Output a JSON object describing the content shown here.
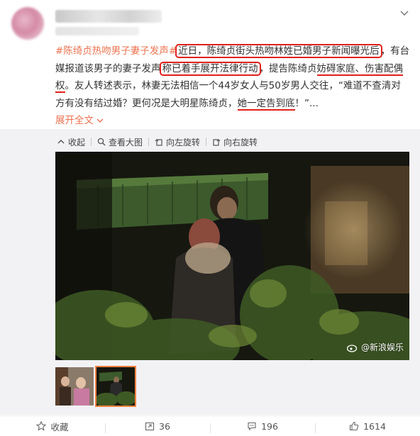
{
  "colors": {
    "accent": "#eb7350",
    "highlight": "#e0201a",
    "thumb_border": "#ff8140"
  },
  "post": {
    "topic": "#陈绮贞热吻男子妻子发声#",
    "seg1": "近日，陈绮贞街头热吻林姓已婚男子新闻曝光后",
    "seg2": "，有台媒报道该男子的妻子发声",
    "seg3": "称已着手展开法律行动",
    "seg4": "，提告陈绮贞",
    "seg5": "妨碍家庭、伤害配偶权",
    "seg6": "。",
    "seg7": "友人转述表示，林妻无法相信一个44岁女人与50岁男人交往，“难道不查清对方有没有结过婚？更何况是大明星陈绮贞，",
    "seg8": "她一定告到底",
    "seg9": "！”...",
    "expand_label": "展开全文",
    "expand_icon": "chevron-down-icon"
  },
  "image_toolbar": {
    "collapse_label": "收起",
    "view_large_label": "查看大图",
    "rotate_left_label": "向左旋转",
    "rotate_right_label": "向右旋转"
  },
  "photo": {
    "watermark": "@新浪娱乐"
  },
  "thumbnails": {
    "count": 2,
    "active_index": 1
  },
  "footer": {
    "favorite_label": "收藏",
    "repost_count": "36",
    "comment_count": "196",
    "like_count": "1614"
  }
}
